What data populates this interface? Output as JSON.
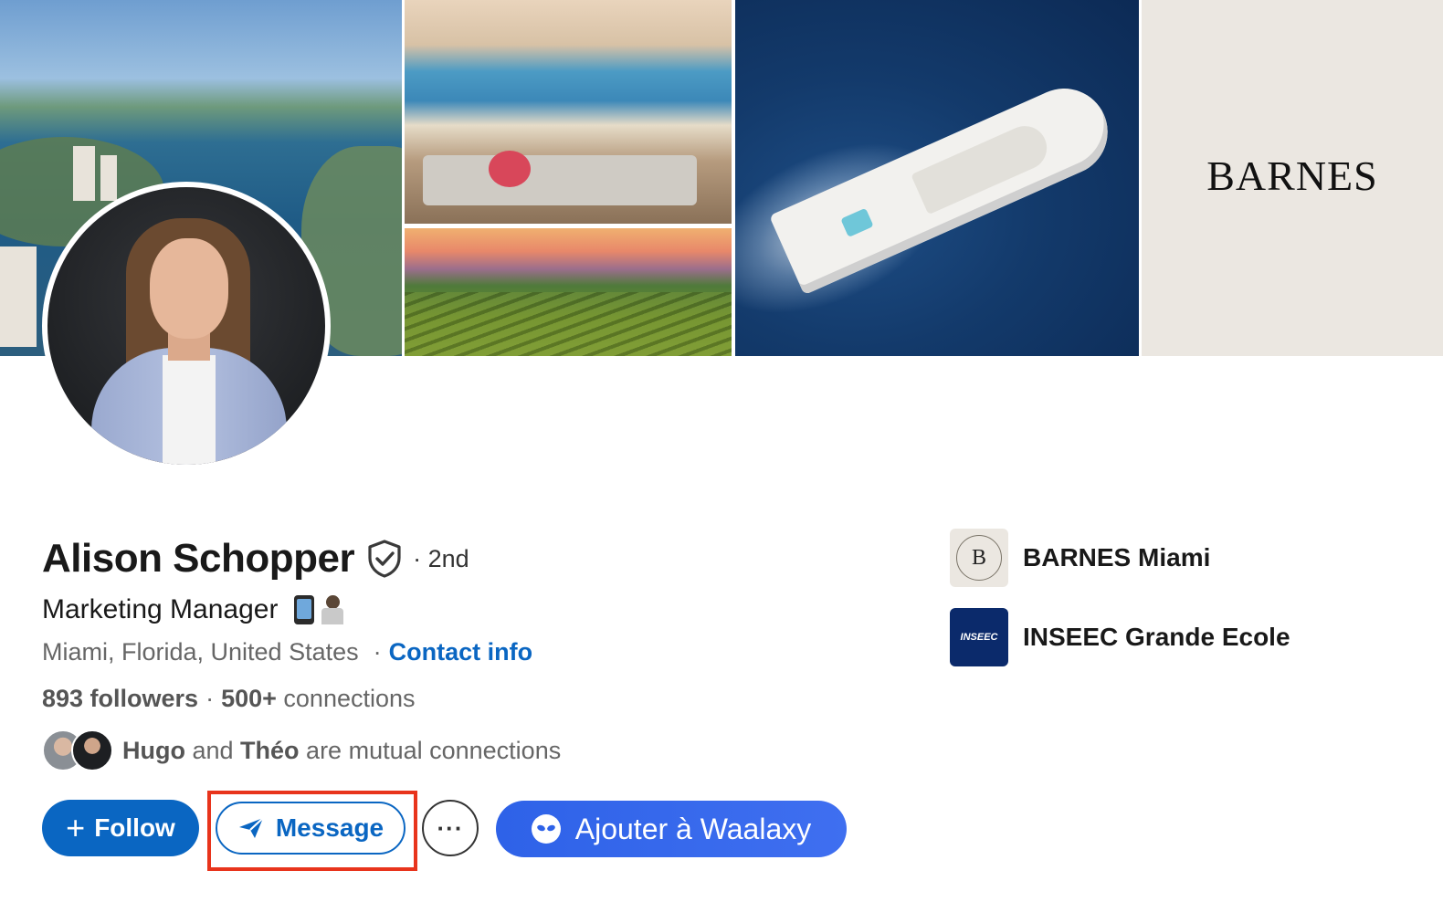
{
  "banner": {
    "brand_text": "BARNES"
  },
  "profile": {
    "name": "Alison Schopper",
    "degree": "· 2nd",
    "headline": "Marketing Manager",
    "location": "Miami, Florida, United States",
    "contact_label": "Contact info",
    "followers": "893 followers",
    "connections_count": "500+",
    "connections_label": " connections",
    "mutual": {
      "first": "Hugo",
      "and": " and ",
      "second": "Théo",
      "suffix": " are mutual connections"
    }
  },
  "actions": {
    "follow_label": "Follow",
    "message_label": "Message",
    "more_label": "···",
    "waalaxy_label": "Ajouter à Waalaxy"
  },
  "organizations": [
    {
      "name": "BARNES Miami",
      "logo_text": "B"
    },
    {
      "name": "INSEEC Grande Ecole",
      "logo_text": "INSEEC"
    }
  ],
  "colors": {
    "primary": "#0a66c2",
    "highlight": "#e8341c",
    "waalaxy": "#2e62e8"
  }
}
